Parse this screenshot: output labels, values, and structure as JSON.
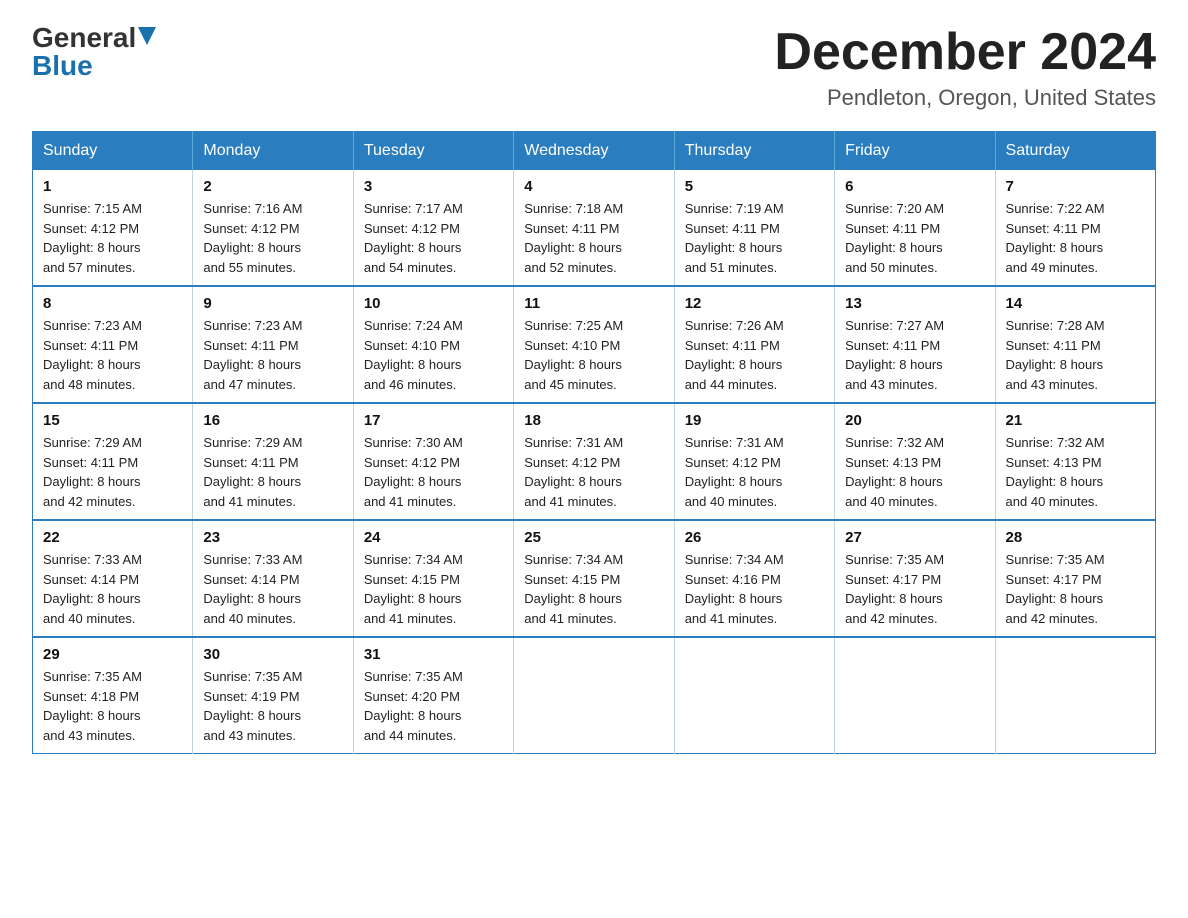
{
  "logo": {
    "general": "General",
    "blue": "Blue",
    "arrow": "▲"
  },
  "title": "December 2024",
  "location": "Pendleton, Oregon, United States",
  "days_of_week": [
    "Sunday",
    "Monday",
    "Tuesday",
    "Wednesday",
    "Thursday",
    "Friday",
    "Saturday"
  ],
  "weeks": [
    [
      {
        "day": "1",
        "sunrise": "7:15 AM",
        "sunset": "4:12 PM",
        "daylight": "8 hours and 57 minutes."
      },
      {
        "day": "2",
        "sunrise": "7:16 AM",
        "sunset": "4:12 PM",
        "daylight": "8 hours and 55 minutes."
      },
      {
        "day": "3",
        "sunrise": "7:17 AM",
        "sunset": "4:12 PM",
        "daylight": "8 hours and 54 minutes."
      },
      {
        "day": "4",
        "sunrise": "7:18 AM",
        "sunset": "4:11 PM",
        "daylight": "8 hours and 52 minutes."
      },
      {
        "day": "5",
        "sunrise": "7:19 AM",
        "sunset": "4:11 PM",
        "daylight": "8 hours and 51 minutes."
      },
      {
        "day": "6",
        "sunrise": "7:20 AM",
        "sunset": "4:11 PM",
        "daylight": "8 hours and 50 minutes."
      },
      {
        "day": "7",
        "sunrise": "7:22 AM",
        "sunset": "4:11 PM",
        "daylight": "8 hours and 49 minutes."
      }
    ],
    [
      {
        "day": "8",
        "sunrise": "7:23 AM",
        "sunset": "4:11 PM",
        "daylight": "8 hours and 48 minutes."
      },
      {
        "day": "9",
        "sunrise": "7:23 AM",
        "sunset": "4:11 PM",
        "daylight": "8 hours and 47 minutes."
      },
      {
        "day": "10",
        "sunrise": "7:24 AM",
        "sunset": "4:10 PM",
        "daylight": "8 hours and 46 minutes."
      },
      {
        "day": "11",
        "sunrise": "7:25 AM",
        "sunset": "4:10 PM",
        "daylight": "8 hours and 45 minutes."
      },
      {
        "day": "12",
        "sunrise": "7:26 AM",
        "sunset": "4:11 PM",
        "daylight": "8 hours and 44 minutes."
      },
      {
        "day": "13",
        "sunrise": "7:27 AM",
        "sunset": "4:11 PM",
        "daylight": "8 hours and 43 minutes."
      },
      {
        "day": "14",
        "sunrise": "7:28 AM",
        "sunset": "4:11 PM",
        "daylight": "8 hours and 43 minutes."
      }
    ],
    [
      {
        "day": "15",
        "sunrise": "7:29 AM",
        "sunset": "4:11 PM",
        "daylight": "8 hours and 42 minutes."
      },
      {
        "day": "16",
        "sunrise": "7:29 AM",
        "sunset": "4:11 PM",
        "daylight": "8 hours and 41 minutes."
      },
      {
        "day": "17",
        "sunrise": "7:30 AM",
        "sunset": "4:12 PM",
        "daylight": "8 hours and 41 minutes."
      },
      {
        "day": "18",
        "sunrise": "7:31 AM",
        "sunset": "4:12 PM",
        "daylight": "8 hours and 41 minutes."
      },
      {
        "day": "19",
        "sunrise": "7:31 AM",
        "sunset": "4:12 PM",
        "daylight": "8 hours and 40 minutes."
      },
      {
        "day": "20",
        "sunrise": "7:32 AM",
        "sunset": "4:13 PM",
        "daylight": "8 hours and 40 minutes."
      },
      {
        "day": "21",
        "sunrise": "7:32 AM",
        "sunset": "4:13 PM",
        "daylight": "8 hours and 40 minutes."
      }
    ],
    [
      {
        "day": "22",
        "sunrise": "7:33 AM",
        "sunset": "4:14 PM",
        "daylight": "8 hours and 40 minutes."
      },
      {
        "day": "23",
        "sunrise": "7:33 AM",
        "sunset": "4:14 PM",
        "daylight": "8 hours and 40 minutes."
      },
      {
        "day": "24",
        "sunrise": "7:34 AM",
        "sunset": "4:15 PM",
        "daylight": "8 hours and 41 minutes."
      },
      {
        "day": "25",
        "sunrise": "7:34 AM",
        "sunset": "4:15 PM",
        "daylight": "8 hours and 41 minutes."
      },
      {
        "day": "26",
        "sunrise": "7:34 AM",
        "sunset": "4:16 PM",
        "daylight": "8 hours and 41 minutes."
      },
      {
        "day": "27",
        "sunrise": "7:35 AM",
        "sunset": "4:17 PM",
        "daylight": "8 hours and 42 minutes."
      },
      {
        "day": "28",
        "sunrise": "7:35 AM",
        "sunset": "4:17 PM",
        "daylight": "8 hours and 42 minutes."
      }
    ],
    [
      {
        "day": "29",
        "sunrise": "7:35 AM",
        "sunset": "4:18 PM",
        "daylight": "8 hours and 43 minutes."
      },
      {
        "day": "30",
        "sunrise": "7:35 AM",
        "sunset": "4:19 PM",
        "daylight": "8 hours and 43 minutes."
      },
      {
        "day": "31",
        "sunrise": "7:35 AM",
        "sunset": "4:20 PM",
        "daylight": "8 hours and 44 minutes."
      },
      null,
      null,
      null,
      null
    ]
  ],
  "labels": {
    "sunrise_prefix": "Sunrise: ",
    "sunset_prefix": "Sunset: ",
    "daylight_prefix": "Daylight: "
  }
}
